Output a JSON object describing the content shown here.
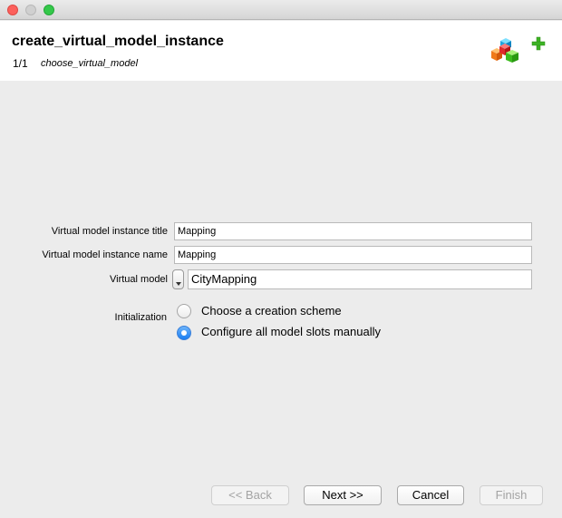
{
  "window": {
    "controls": [
      "close",
      "minimize",
      "zoom"
    ]
  },
  "header": {
    "title": "create_virtual_model_instance",
    "step": "1/1",
    "step_name": "choose_virtual_model",
    "icons": [
      "cubes-icon",
      "plus-icon"
    ]
  },
  "form": {
    "title_label": "Virtual model instance title",
    "title_value": "Mapping",
    "name_label": "Virtual model instance name",
    "name_value": "Mapping",
    "model_label": "Virtual model",
    "model_value": "CityMapping",
    "initialization_label": "Initialization",
    "options": [
      {
        "label": "Choose a creation scheme",
        "selected": false
      },
      {
        "label": "Configure all model slots manually",
        "selected": true
      }
    ]
  },
  "buttons": {
    "back": "<< Back",
    "next": "Next >>",
    "cancel": "Cancel",
    "finish": "Finish"
  }
}
